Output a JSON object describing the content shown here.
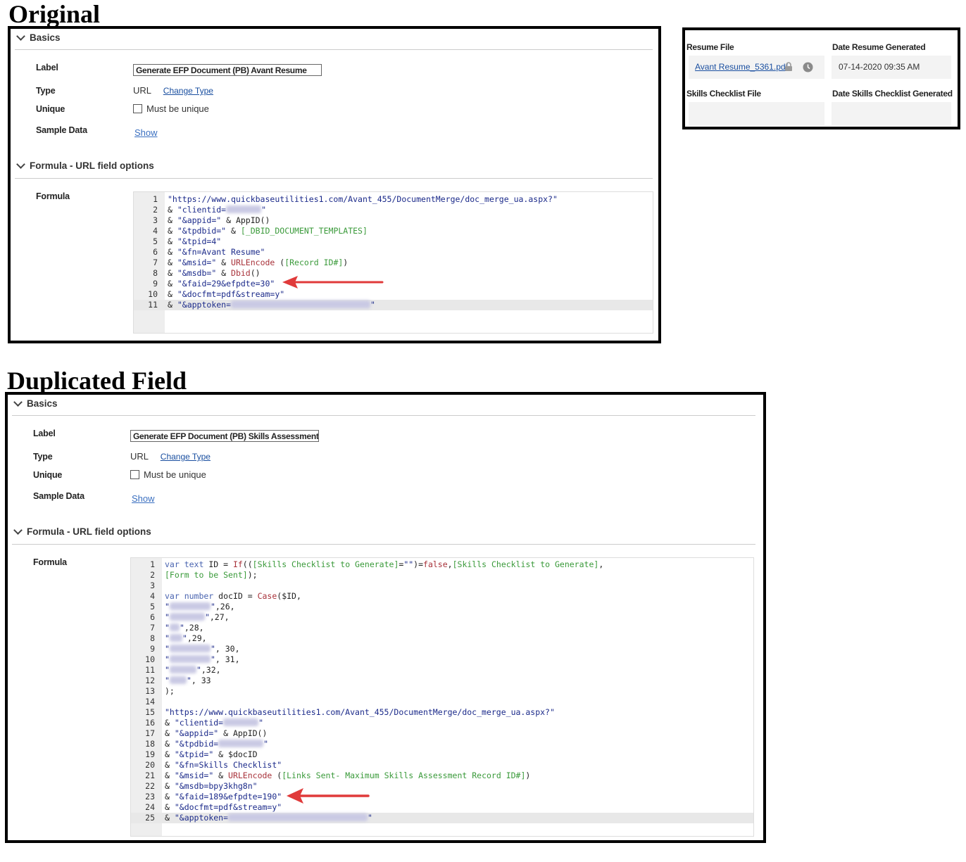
{
  "headings": {
    "original": "Original",
    "duplicated": "Duplicated Field"
  },
  "original": {
    "basics": {
      "title": "Basics",
      "label_caption": "Label",
      "label_value": "Generate EFP Document (PB) Avant Resume",
      "type_caption": "Type",
      "type_value": "URL",
      "change_type": "Change Type",
      "unique_caption": "Unique",
      "unique_text": "Must be unique",
      "sample_caption": "Sample Data",
      "show": "Show"
    },
    "formula_section": {
      "title": "Formula - URL field options",
      "caption": "Formula"
    }
  },
  "duplicated": {
    "basics": {
      "title": "Basics",
      "label_caption": "Label",
      "label_value": "Generate EFP Document (PB) Skills Assessment",
      "type_caption": "Type",
      "type_value": "URL",
      "change_type": "Change Type",
      "unique_caption": "Unique",
      "unique_text": "Must be unique",
      "sample_caption": "Sample Data",
      "show": "Show"
    },
    "formula_section": {
      "title": "Formula - URL field options",
      "caption": "Formula"
    }
  },
  "resume_panel": {
    "resume_file_label": "Resume File",
    "resume_file_link": "Avant Resume_5361.pdf",
    "date_resume_label": "Date Resume Generated",
    "date_resume_value": "07-14-2020 09:35 AM",
    "skills_file_label": "Skills Checklist File",
    "date_skills_label": "Date Skills Checklist Generated"
  },
  "colors": {
    "arrow": "#e03a3a",
    "string": "#1b2a8a",
    "field": "#3a9a3a",
    "function": "#a8323a"
  },
  "icons": [
    "chevron-down-icon",
    "lock-icon",
    "clock-icon",
    "red-arrow-icon"
  ],
  "code_original": [
    {
      "n": "1",
      "t": "\"https://www.quickbaseutilities1.com/Avant_455/DocumentMerge/doc_merge_ua.aspx?\""
    },
    {
      "n": "2",
      "t": "& \"clientid=\""
    },
    {
      "n": "3",
      "t": "& \"&appid=\" & AppID()"
    },
    {
      "n": "4",
      "t": "& \"&tpdbid=\" & [_DBID_DOCUMENT_TEMPLATES]"
    },
    {
      "n": "5",
      "t": "& \"&tpid=4\""
    },
    {
      "n": "6",
      "t": "& \"&fn=Avant Resume\""
    },
    {
      "n": "7",
      "t": "& \"&msid=\" & URLEncode ([Record ID#])"
    },
    {
      "n": "8",
      "t": "& \"&msdb=\" & Dbid()"
    },
    {
      "n": "9",
      "t": "& \"&faid=29&efpdte=30\""
    },
    {
      "n": "10",
      "t": "& \"&docfmt=pdf&stream=y\""
    },
    {
      "n": "11",
      "t": "& \"&apptoken=\""
    }
  ],
  "code_duplicated": [
    {
      "n": "1",
      "t": "var text ID = If(([Skills Checklist to Generate]=\"\")=false,[Skills Checklist to Generate],"
    },
    {
      "n": "2",
      "t": "[Form to be Sent]);"
    },
    {
      "n": "3",
      "t": ""
    },
    {
      "n": "4",
      "t": "var number docID = Case($ID,"
    },
    {
      "n": "5",
      "t": "\"\",26,"
    },
    {
      "n": "6",
      "t": "\"\",27,"
    },
    {
      "n": "7",
      "t": "\"\",28,"
    },
    {
      "n": "8",
      "t": "\"\",29,"
    },
    {
      "n": "9",
      "t": "\"\", 30,"
    },
    {
      "n": "10",
      "t": "\"\", 31,"
    },
    {
      "n": "11",
      "t": "\"\",32,"
    },
    {
      "n": "12",
      "t": "\"\", 33"
    },
    {
      "n": "13",
      "t": ");"
    },
    {
      "n": "14",
      "t": ""
    },
    {
      "n": "15",
      "t": "\"https://www.quickbaseutilities1.com/Avant_455/DocumentMerge/doc_merge_ua.aspx?\""
    },
    {
      "n": "16",
      "t": "& \"clientid=\""
    },
    {
      "n": "17",
      "t": "& \"&appid=\" & AppID()"
    },
    {
      "n": "18",
      "t": "& \"&tpdbid=\""
    },
    {
      "n": "19",
      "t": "& \"&tpid=\" & $docID"
    },
    {
      "n": "20",
      "t": "& \"&fn=Skills Checklist\""
    },
    {
      "n": "21",
      "t": "& \"&msid=\" & URLEncode ([Links Sent- Maximum Skills Assessment Record ID#])"
    },
    {
      "n": "22",
      "t": "& \"&msdb=bpy3khg8n\""
    },
    {
      "n": "23",
      "t": "& \"&faid=189&efpdte=190\""
    },
    {
      "n": "24",
      "t": "& \"&docfmt=pdf&stream=y\""
    },
    {
      "n": "25",
      "t": "& \"&apptoken=\""
    }
  ]
}
